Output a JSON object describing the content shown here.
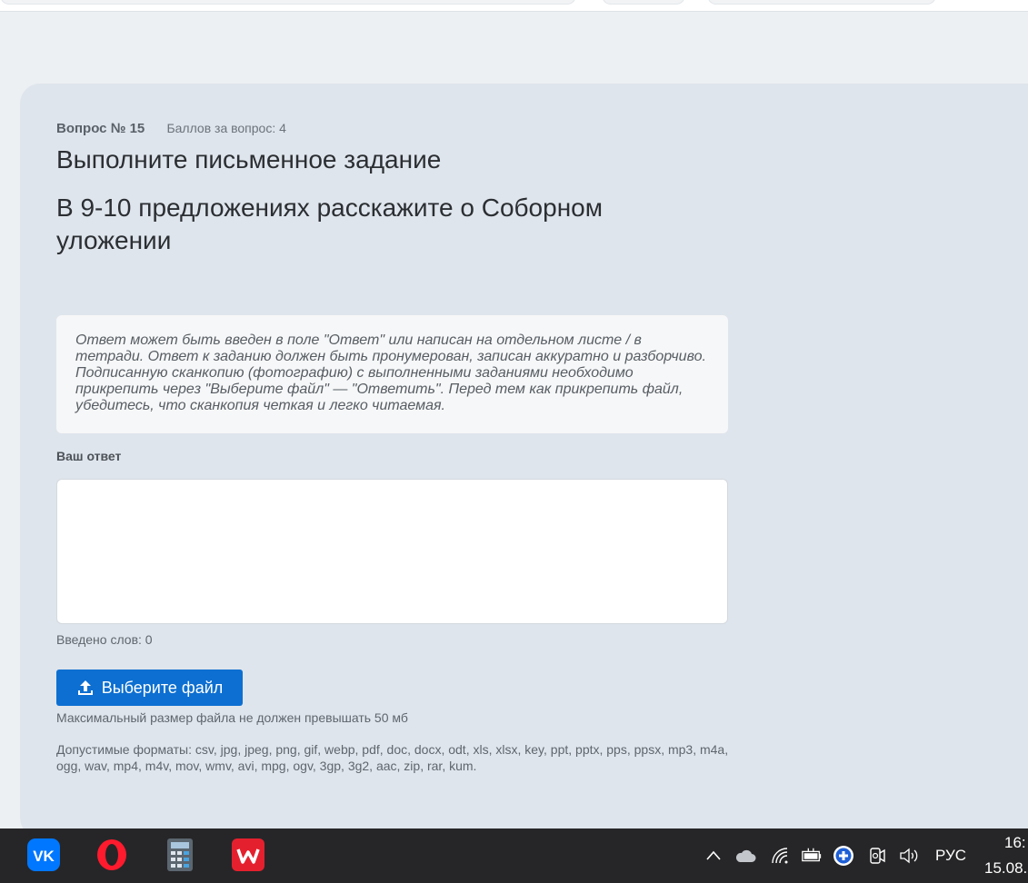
{
  "question": {
    "number_label": "Вопрос № 15",
    "points_label": "Баллов за вопрос: 4",
    "title": "Выполните письменное задание",
    "text": "В 9-10 предложениях расскажите о Соборном уложении"
  },
  "hint": "Ответ может быть введен в поле \"Ответ\" или написан на отдельном листе / в тетради. Ответ к заданию должен быть пронумерован, записан аккуратно и разборчиво. Подписанную сканкопию (фотографию) с выполненными заданиями необходимо прикрепить через \"Выберите файл\" — \"Ответить\". Перед тем как прикрепить файл, убедитесь, что сканкопия четкая и легко читаемая.",
  "answer": {
    "label": "Ваш ответ",
    "value": "",
    "word_count_label": "Введено слов: 0"
  },
  "upload": {
    "button_label": "Выберите файл",
    "max_size_text": "Максимальный размер файла не должен превышать 50 мб",
    "formats_text": "Допустимые форматы: csv, jpg, jpeg, png, gif, webp, pdf, doc, docx, odt, xls, xlsx, key, ppt, pptx, pps, ppsx, mp3, m4a, ogg, wav, mp4, m4v, mov, wmv, avi, mpg, ogv, 3gp, 3g2, aac, zip, rar, kum."
  },
  "taskbar": {
    "apps": [
      {
        "name": "vk-icon",
        "label": "VK",
        "color": "#0077ff"
      },
      {
        "name": "opera-icon",
        "color": "#ff1b2d"
      },
      {
        "name": "calculator-icon",
        "color": "#7a8793"
      },
      {
        "name": "wps-office-icon",
        "color": "#e5202e"
      }
    ],
    "tray_icons": [
      "chevron-up-icon",
      "cloud-icon",
      "wifi-icon",
      "battery-icon",
      "shield-plus-icon",
      "camera-icon",
      "speaker-icon"
    ],
    "language": "РУС",
    "time": "16:",
    "date": "15.08."
  },
  "colors": {
    "accent": "#0d6fd1",
    "background": "#ecf0f3",
    "card": "#dfe5ec",
    "taskbar": "#262628"
  }
}
